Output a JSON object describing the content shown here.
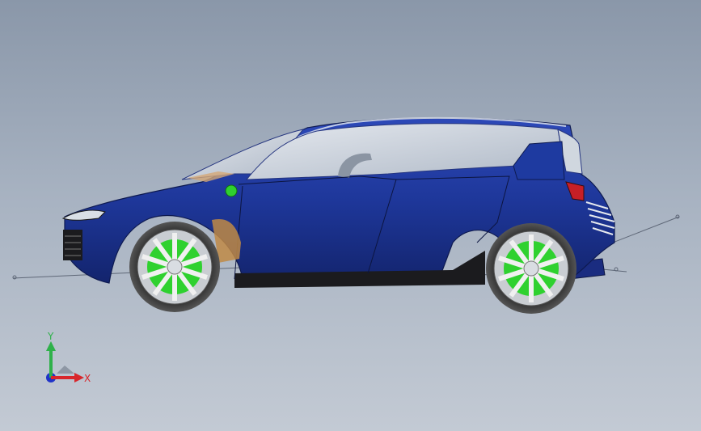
{
  "viewport": {
    "background_top": "#8a97a9",
    "background_bottom": "#c3cad4"
  },
  "model": {
    "body_color": "#1f3a9a",
    "rim_accent_color": "#2fd12f",
    "glass_color": "#c9d2dc"
  },
  "triad": {
    "x_label": "X",
    "y_label": "Y",
    "x_color": "#d8262b",
    "y_color": "#2fb14a",
    "z_color": "#1f33c8"
  }
}
